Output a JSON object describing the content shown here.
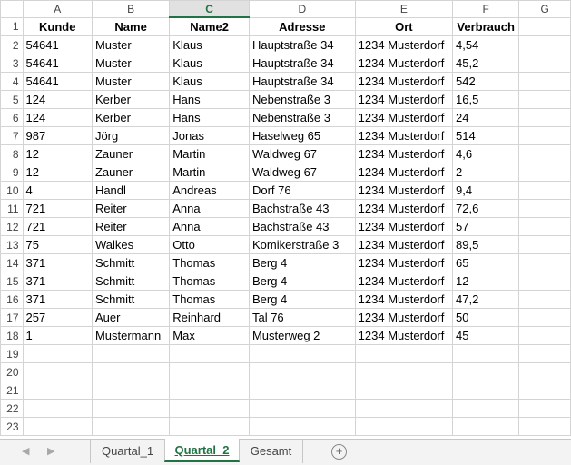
{
  "columns": [
    "A",
    "B",
    "C",
    "D",
    "E",
    "F",
    "G"
  ],
  "active_column": "C",
  "header": [
    "Kunde",
    "Name",
    "Name2",
    "Adresse",
    "Ort",
    "Verbrauch"
  ],
  "rows": [
    [
      "54641",
      "Muster",
      "Klaus",
      "Hauptstraße 34",
      "1234 Musterdorf",
      "4,54"
    ],
    [
      "54641",
      "Muster",
      "Klaus",
      "Hauptstraße 34",
      "1234 Musterdorf",
      "45,2"
    ],
    [
      "54641",
      "Muster",
      "Klaus",
      "Hauptstraße 34",
      "1234 Musterdorf",
      "542"
    ],
    [
      "124",
      "Kerber",
      "Hans",
      "Nebenstraße 3",
      "1234 Musterdorf",
      "16,5"
    ],
    [
      "124",
      "Kerber",
      "Hans",
      "Nebenstraße 3",
      "1234 Musterdorf",
      "24"
    ],
    [
      "987",
      "Jörg",
      "Jonas",
      "Haselweg 65",
      "1234 Musterdorf",
      "514"
    ],
    [
      "12",
      "Zauner",
      "Martin",
      "Waldweg 67",
      "1234 Musterdorf",
      "4,6"
    ],
    [
      "12",
      "Zauner",
      "Martin",
      "Waldweg 67",
      "1234 Musterdorf",
      "2"
    ],
    [
      "4",
      "Handl",
      "Andreas",
      "Dorf 76",
      "1234 Musterdorf",
      "9,4"
    ],
    [
      "721",
      "Reiter",
      "Anna",
      "Bachstraße 43",
      "1234 Musterdorf",
      "72,6"
    ],
    [
      "721",
      "Reiter",
      "Anna",
      "Bachstraße 43",
      "1234 Musterdorf",
      "57"
    ],
    [
      "75",
      "Walkes",
      "Otto",
      "Komikerstraße 3",
      "1234 Musterdorf",
      "89,5"
    ],
    [
      "371",
      "Schmitt",
      "Thomas",
      "Berg 4",
      "1234 Musterdorf",
      "65"
    ],
    [
      "371",
      "Schmitt",
      "Thomas",
      "Berg 4",
      "1234 Musterdorf",
      "12"
    ],
    [
      "371",
      "Schmitt",
      "Thomas",
      "Berg 4",
      "1234 Musterdorf",
      "47,2"
    ],
    [
      "257",
      "Auer",
      "Reinhard",
      "Tal 76",
      "1234 Musterdorf",
      "50"
    ],
    [
      "1",
      "Mustermann",
      "Max",
      "Musterweg 2",
      "1234 Musterdorf",
      "45"
    ]
  ],
  "row_numbers": [
    "1",
    "2",
    "3",
    "4",
    "5",
    "6",
    "7",
    "8",
    "9",
    "10",
    "11",
    "12",
    "13",
    "14",
    "15",
    "16",
    "17",
    "18",
    "19",
    "20",
    "21",
    "22",
    "23"
  ],
  "tabs": [
    {
      "label": "Quartal_1",
      "active": false
    },
    {
      "label": "Quartal_2",
      "active": true
    },
    {
      "label": "Gesamt",
      "active": false
    }
  ],
  "icons": {
    "scroll_left": "triangle-left-icon",
    "scroll_right": "triangle-right-icon",
    "add_sheet": "plus-circle-icon"
  },
  "colors": {
    "accent": "#217346",
    "grid": "#d4d4d4",
    "tabbar": "#f3f3f3"
  }
}
